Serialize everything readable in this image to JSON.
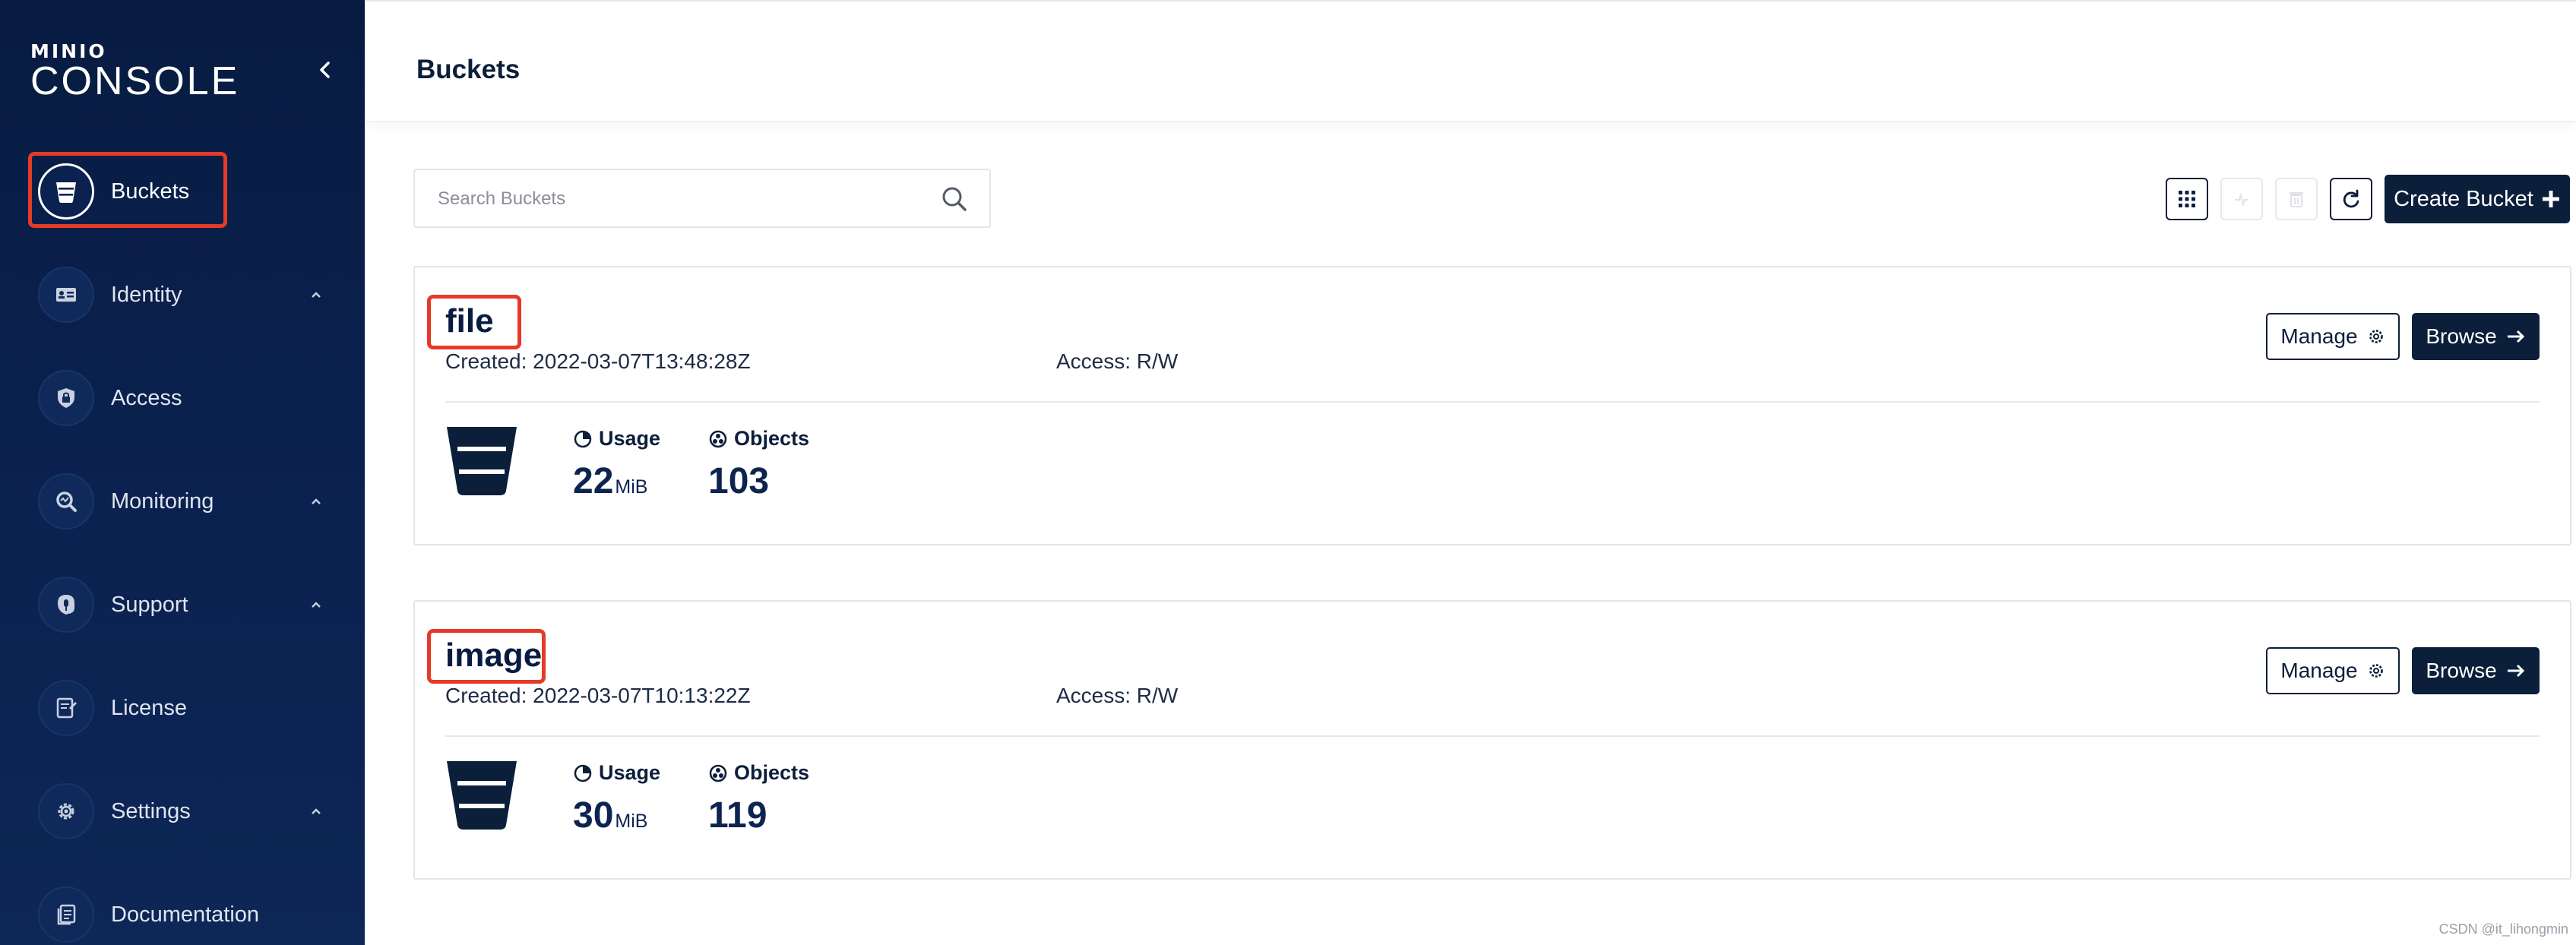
{
  "app": {
    "logo_top": "MINIO",
    "logo_main": "CONSOLE"
  },
  "sidebar": {
    "items": [
      {
        "label": "Buckets",
        "icon": "bucket-icon",
        "active": true,
        "expandable": false
      },
      {
        "label": "Identity",
        "icon": "id-card-icon",
        "active": false,
        "expandable": true
      },
      {
        "label": "Access",
        "icon": "lock-shield-icon",
        "active": false,
        "expandable": false
      },
      {
        "label": "Monitoring",
        "icon": "magnifier-chart-icon",
        "active": false,
        "expandable": true
      },
      {
        "label": "Support",
        "icon": "support-icon",
        "active": false,
        "expandable": true
      },
      {
        "label": "License",
        "icon": "license-icon",
        "active": false,
        "expandable": false
      },
      {
        "label": "Settings",
        "icon": "gear-icon",
        "active": false,
        "expandable": true
      },
      {
        "label": "Documentation",
        "icon": "document-icon",
        "active": false,
        "expandable": false
      }
    ]
  },
  "header": {
    "title": "Buckets"
  },
  "toolbar": {
    "search_placeholder": "Search Buckets",
    "create_label": "Create Bucket"
  },
  "buckets": [
    {
      "name": "file",
      "created": "Created: 2022-03-07T13:48:28Z",
      "access": "Access: R/W",
      "usage_label": "Usage",
      "usage_value": "22",
      "usage_unit": "MiB",
      "objects_label": "Objects",
      "objects_value": "103",
      "manage_label": "Manage",
      "browse_label": "Browse"
    },
    {
      "name": "image",
      "created": "Created: 2022-03-07T10:13:22Z",
      "access": "Access: R/W",
      "usage_label": "Usage",
      "usage_value": "30",
      "usage_unit": "MiB",
      "objects_label": "Objects",
      "objects_value": "119",
      "manage_label": "Manage",
      "browse_label": "Browse"
    }
  ],
  "watermark": "CSDN @it_lihongmin",
  "colors": {
    "sidebar_bg": "#081c42",
    "primary": "#0b1e3a",
    "highlight": "#e53a28"
  }
}
